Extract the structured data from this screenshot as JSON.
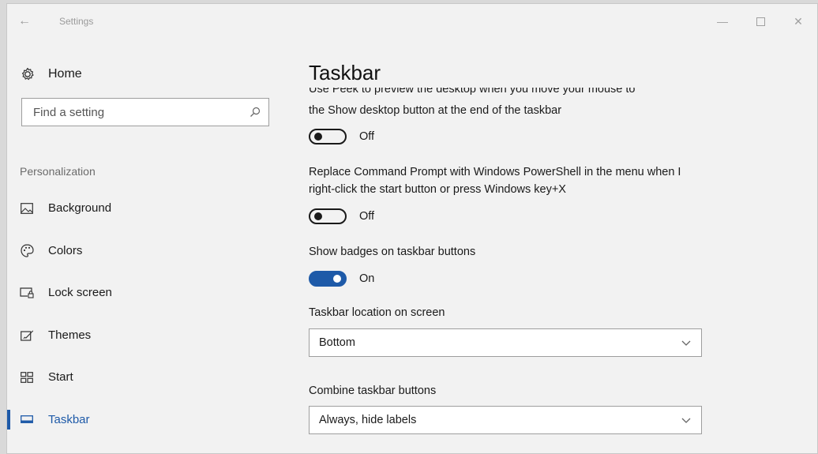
{
  "window": {
    "title": "Settings"
  },
  "sidebar": {
    "home_label": "Home",
    "search_placeholder": "Find a setting",
    "section_label": "Personalization",
    "items": [
      {
        "label": "Background",
        "icon": "image-icon"
      },
      {
        "label": "Colors",
        "icon": "palette-icon"
      },
      {
        "label": "Lock screen",
        "icon": "lock-screen-icon"
      },
      {
        "label": "Themes",
        "icon": "themes-icon"
      },
      {
        "label": "Start",
        "icon": "start-icon"
      },
      {
        "label": "Taskbar",
        "icon": "taskbar-icon",
        "active": true
      }
    ]
  },
  "main": {
    "title": "Taskbar",
    "peek": {
      "text_cut": "Use Peek to preview the desktop when you move your mouse to",
      "text_line2": "the Show desktop button at the end of the taskbar",
      "state": "Off"
    },
    "powershell": {
      "text": "Replace Command Prompt with Windows PowerShell in the menu when I right-click the start button or press Windows key+X",
      "state": "Off"
    },
    "badges": {
      "text": "Show badges on taskbar buttons",
      "state": "On"
    },
    "location": {
      "label": "Taskbar location on screen",
      "value": "Bottom"
    },
    "combine": {
      "label": "Combine taskbar buttons",
      "value": "Always, hide labels"
    }
  },
  "colors": {
    "accent": "#1e5aa8"
  }
}
